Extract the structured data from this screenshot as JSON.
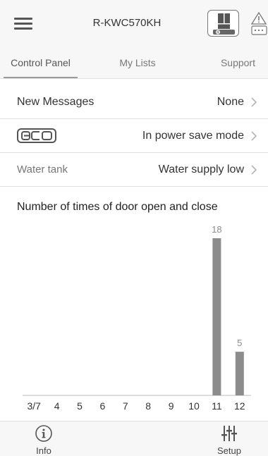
{
  "header": {
    "title": "R-KWC570KH",
    "menu_icon": "hamburger-menu-icon",
    "fridge_icon": "fridge-status-icon",
    "alert_icon": "warning-alert-icon"
  },
  "tabs": [
    {
      "label": "Control Panel",
      "active": true
    },
    {
      "label": "My Lists",
      "active": false
    },
    {
      "label": "Support",
      "active": false
    }
  ],
  "rows": {
    "messages": {
      "label": "New Messages",
      "value": "None"
    },
    "eco": {
      "label": "eco",
      "value": "In power save mode"
    },
    "water": {
      "label": "Water tank",
      "value": "Water supply low"
    }
  },
  "chart_data": {
    "type": "bar",
    "title": "Number of times of door open and close",
    "categories": [
      "3/7",
      "4",
      "5",
      "6",
      "7",
      "8",
      "9",
      "10",
      "11",
      "12"
    ],
    "values": [
      0,
      0,
      0,
      0,
      0,
      0,
      0,
      0,
      18,
      5
    ],
    "ylim": [
      0,
      18
    ],
    "bar_color": "#8c8c8c",
    "data_labels_shown_for_nonzero": true
  },
  "bottom_nav": {
    "info": {
      "label": "Info",
      "icon": "info-icon"
    },
    "setup": {
      "label": "Setup",
      "icon": "sliders-setup-icon"
    }
  },
  "colors": {
    "header_bg": "#f7f7f7",
    "divider": "#e2e2e2",
    "bar": "#8c8c8c"
  }
}
